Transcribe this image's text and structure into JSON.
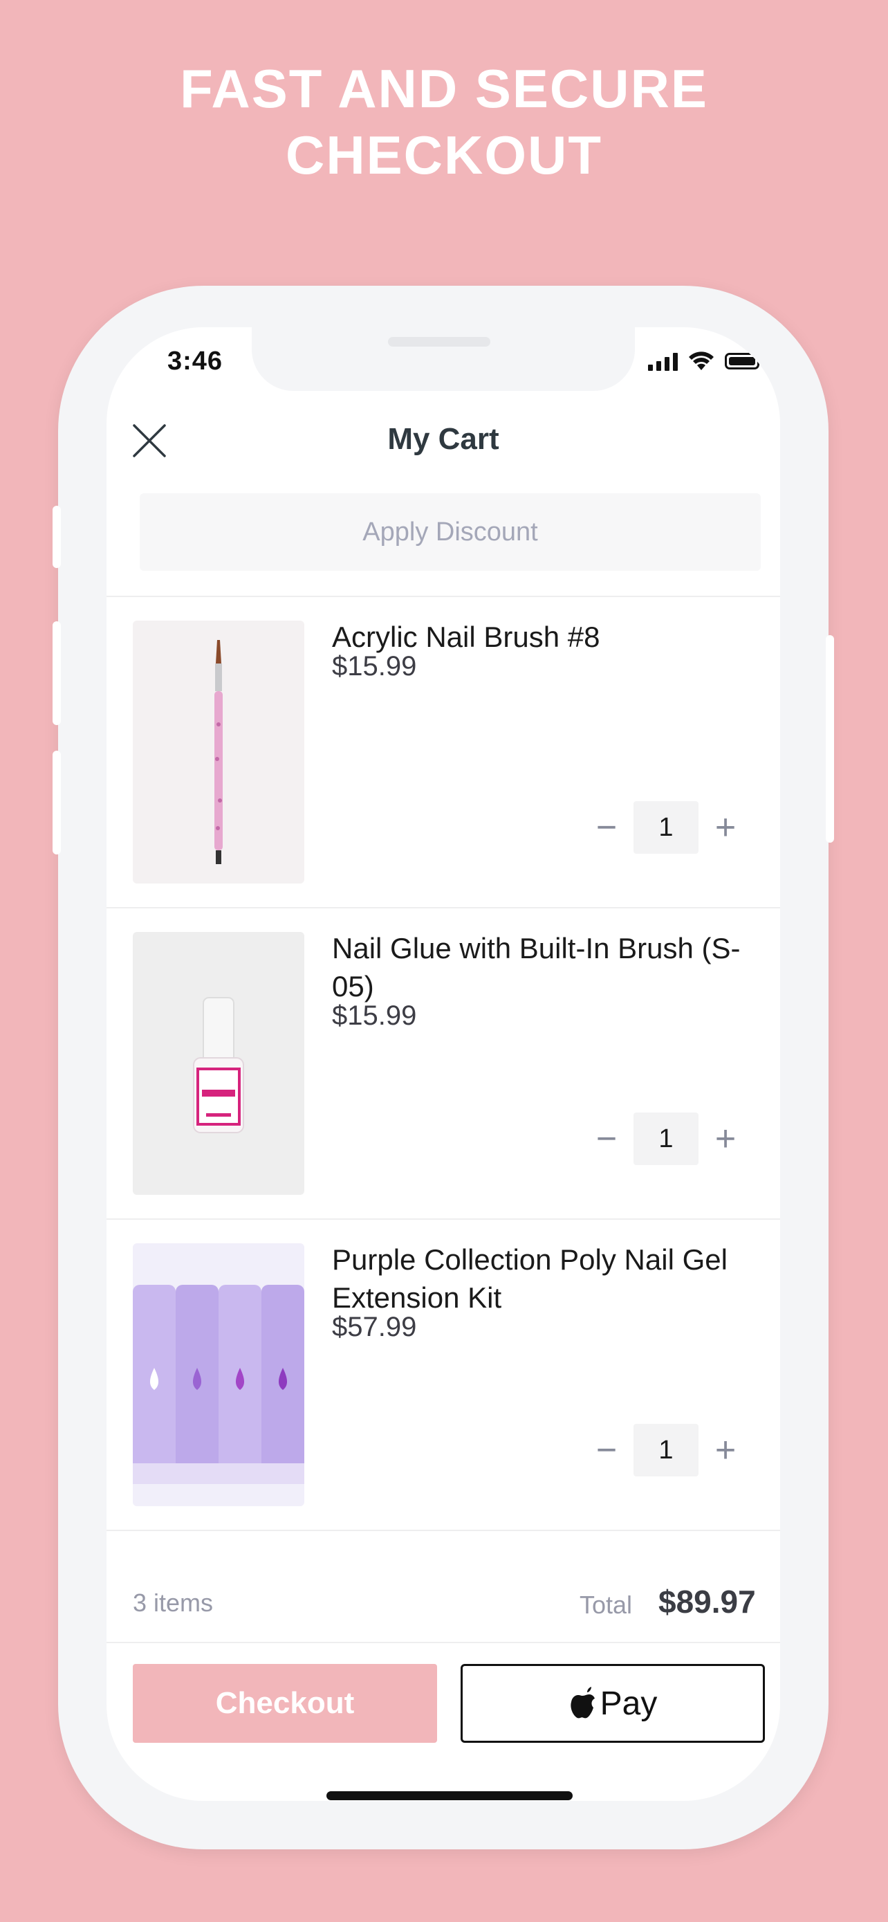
{
  "headline": {
    "line1": "FAST AND SECURE",
    "line2": "CHECKOUT"
  },
  "status_bar": {
    "time": "3:46"
  },
  "header": {
    "title": "My Cart",
    "close_icon": "close-icon"
  },
  "discount": {
    "label": "Apply Discount"
  },
  "cart": {
    "items": [
      {
        "name": "Acrylic Nail Brush #8",
        "price": "$15.99",
        "quantity": "1"
      },
      {
        "name": "Nail Glue with Built-In Brush (S-05)",
        "price": "$15.99",
        "quantity": "1"
      },
      {
        "name": "Purple Collection Poly Nail Gel Extension Kit",
        "price": "$57.99",
        "quantity": "1"
      }
    ],
    "quantity_controls": {
      "minus": "−",
      "plus": "+"
    }
  },
  "summary": {
    "count": "3 items",
    "total_label": "Total",
    "total_value": "$89.97"
  },
  "actions": {
    "checkout": "Checkout",
    "applepay": "Pay"
  },
  "colors": {
    "background": "#f2b6ba",
    "checkout_button": "#f2b6ba",
    "text_dark": "#2f3940"
  }
}
